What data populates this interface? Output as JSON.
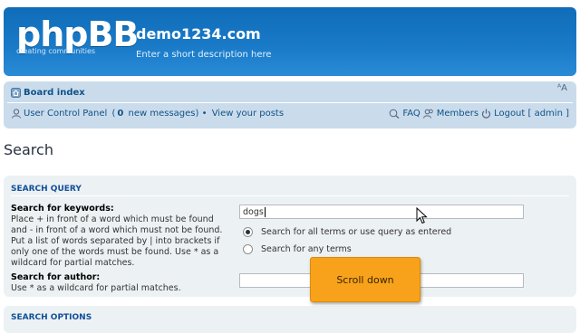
{
  "header": {
    "logo_main": "phpBB",
    "logo_tagline": "creating communities",
    "site_title": "demo1234.com",
    "site_description": "Enter a short description here"
  },
  "navbar": {
    "board_index": "Board index",
    "font_size_control": "ᴬA",
    "user_control_panel": "User Control Panel",
    "new_messages_prefix": " (",
    "new_messages_count": "0",
    "new_messages_suffix": " new messages) • ",
    "view_your_posts": "View your posts",
    "faq": "FAQ",
    "members": "Members",
    "logout": "Logout [ admin ]"
  },
  "page": {
    "title": "Search"
  },
  "search_query": {
    "heading": "SEARCH QUERY",
    "keywords_label": "Search for keywords:",
    "keywords_help_1": "Place + in front of a word which must be found",
    "keywords_help_2": "and - in front of a word which must not be found.",
    "keywords_help_3": "Put a list of words separated by | into brackets if",
    "keywords_help_4": "only one of the words must be found. Use * as a",
    "keywords_help_5": "wildcard for partial matches.",
    "keywords_value": "dogs",
    "terms_options": [
      {
        "label": "Search for all terms or use query as entered",
        "selected": true
      },
      {
        "label": "Search for any terms",
        "selected": false
      }
    ],
    "author_label": "Search for author:",
    "author_help": "Use * as a wildcard for partial matches.",
    "author_value": ""
  },
  "search_options": {
    "heading": "SEARCH OPTIONS"
  },
  "overlay": {
    "tooltip_text": "Scroll down"
  },
  "colors": {
    "header_blue": "#1a7bc9",
    "navbar_bg": "#cadceb",
    "panel_bg": "#ecf1f3",
    "link_blue": "#105289",
    "tooltip_orange": "#f7a21a"
  }
}
